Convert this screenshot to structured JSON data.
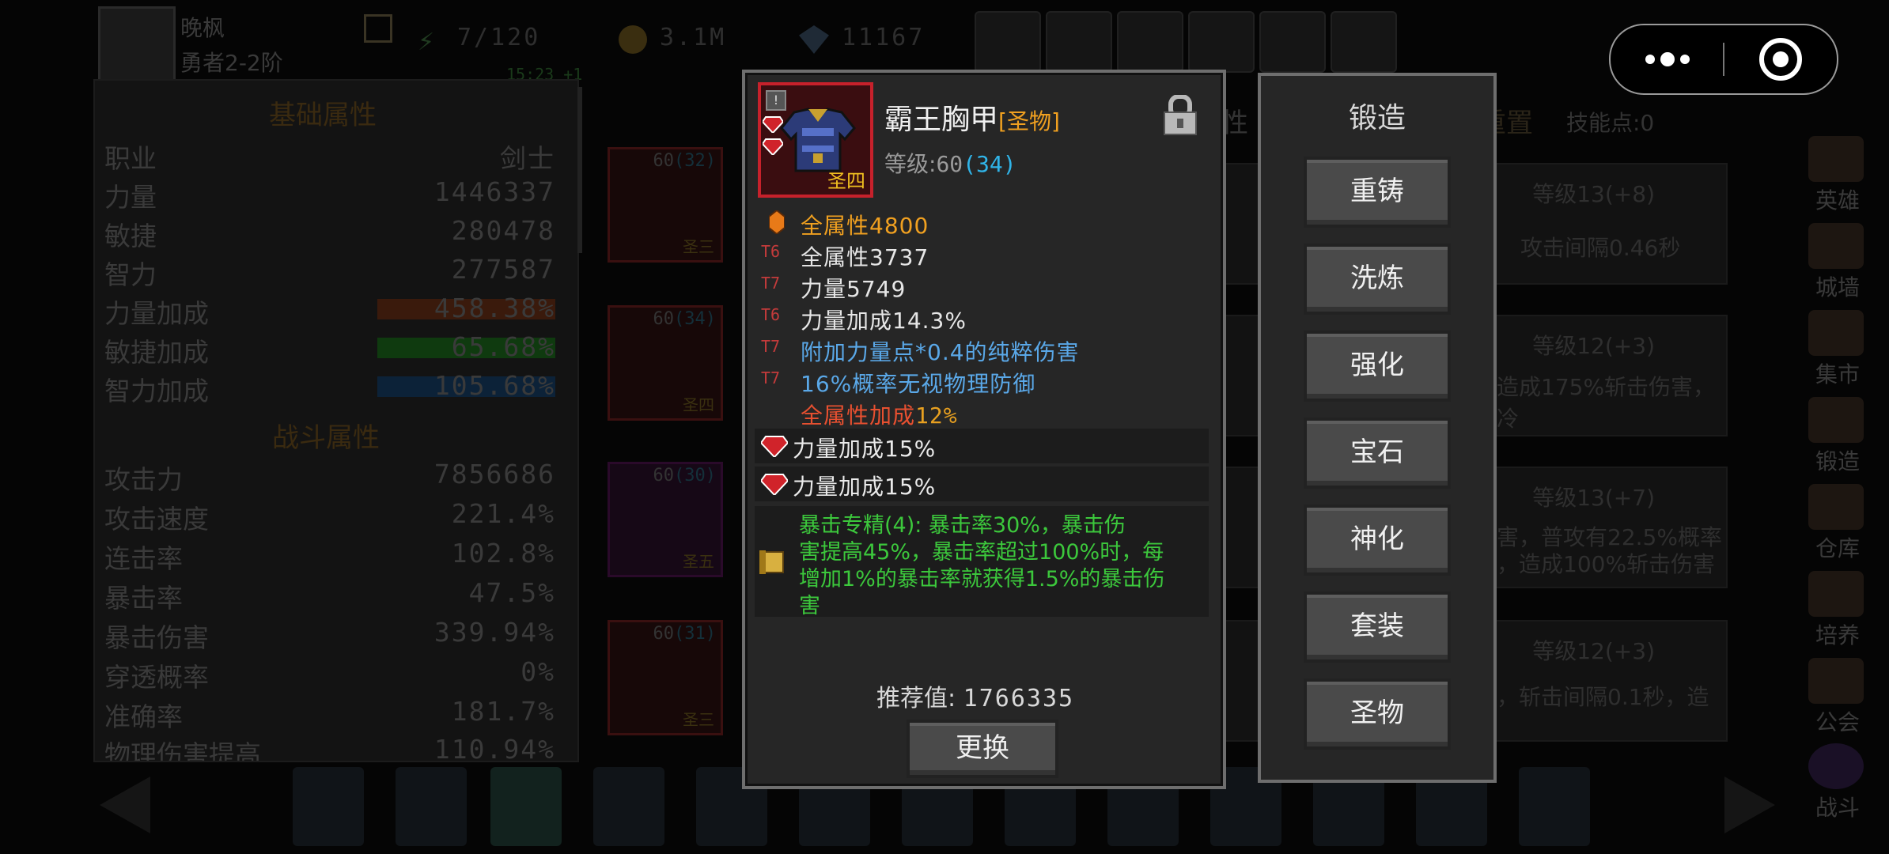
{
  "header": {
    "player_name": "晚枫",
    "player_rank": "勇者2-2阶",
    "stamina": "7/120",
    "stamina_timer": "15:23 +1",
    "gold": "3.1M",
    "diamonds": "11167"
  },
  "capsule": {
    "more_icon": "dots-icon",
    "close_icon": "target-icon"
  },
  "left_panel": {
    "basic_title": "基础属性",
    "basic_stats": [
      {
        "name": "职业",
        "value": "剑士"
      },
      {
        "name": "力量",
        "value": "1446337"
      },
      {
        "name": "敏捷",
        "value": "280478"
      },
      {
        "name": "智力",
        "value": "277587"
      },
      {
        "name": "力量加成",
        "value": "458.38%",
        "bar_color": "#3a1a0c"
      },
      {
        "name": "敏捷加成",
        "value": "65.68%",
        "bar_color": "#0f3a0f"
      },
      {
        "name": "智力加成",
        "value": "105.68%",
        "bar_color": "#0c2238"
      }
    ],
    "combat_title": "战斗属性",
    "combat_stats": [
      {
        "name": "攻击力",
        "value": "7856686"
      },
      {
        "name": "攻击速度",
        "value": "221.4%"
      },
      {
        "name": "连击率",
        "value": "102.8%"
      },
      {
        "name": "暴击率",
        "value": "47.5%"
      },
      {
        "name": "暴击伤害",
        "value": "339.94%"
      },
      {
        "name": "穿透概率",
        "value": "0%"
      },
      {
        "name": "准确率",
        "value": "181.7%"
      },
      {
        "name": "物理伤害提高",
        "value": "110.94%"
      }
    ]
  },
  "equipped_items": [
    {
      "level": "60",
      "extra": "(32)",
      "tag": "圣三"
    },
    {
      "level": "60",
      "extra": "(34)",
      "tag": "圣四"
    },
    {
      "level": "60",
      "extra": "(30)",
      "tag": "圣五"
    },
    {
      "level": "60",
      "extra": "(31)",
      "tag": "圣三"
    }
  ],
  "skills": {
    "tab_partial": "性",
    "reset_label": "重置",
    "skill_points": "技能点:0",
    "cards": [
      {
        "level": "等级13(+8)",
        "desc": "攻击间隔0.46秒"
      },
      {
        "level": "等级12(+3)",
        "desc": "造成175%斩击伤害，冷"
      },
      {
        "level": "等级13(+7)",
        "desc": "害，普攻有22.5%概率",
        "desc2": "，造成100%斩击伤害"
      },
      {
        "level": "等级12(+3)",
        "desc": "，斩击间隔0.1秒，造"
      }
    ]
  },
  "right_nav": [
    "英雄",
    "城墙",
    "集市",
    "锻造",
    "仓库",
    "培养",
    "公会",
    "战斗"
  ],
  "item": {
    "name": "霸王胸甲",
    "quality": "[圣物]",
    "grade_badge": "圣四",
    "level_label": "等级:",
    "level": "60",
    "level_extra": "(34)",
    "lock_icon": "lock-icon",
    "main_stat": "全属性4800",
    "affixes": [
      {
        "tier": "T6",
        "text": "全属性3737",
        "color": "#e6e6e6"
      },
      {
        "tier": "T7",
        "text": "力量5749",
        "color": "#e6e6e6"
      },
      {
        "tier": "T6",
        "text": "力量加成14.3%",
        "color": "#e6e6e6"
      },
      {
        "tier": "T7",
        "text": "附加力量点*0.4的纯粹伤害",
        "color": "#5aa8e8"
      },
      {
        "tier": "T7",
        "text": "16%概率无视物理防御",
        "color": "#5aa8e8"
      }
    ],
    "bonus_prefix": "全属性加成",
    "bonus_value": "12%",
    "gems": [
      "力量加成15%",
      "力量加成15%"
    ],
    "set_effect": {
      "line1": "暴击专精(4): 暴击率30%，暴击伤",
      "line2": "害提高45%，暴击率超过100%时，每",
      "line3": "增加1%的暴击率就获得1.5%的暴击伤",
      "line4": "害"
    },
    "recommend_label": "推荐值:",
    "recommend_value": "1766335",
    "replace_label": "更换"
  },
  "forge": {
    "title": "锻造",
    "buttons": [
      "重铸",
      "洗炼",
      "强化",
      "宝石",
      "神化",
      "套装",
      "圣物"
    ]
  },
  "colors": {
    "popup_bg": "#262626",
    "orange": "#f0a020",
    "cyan": "#30b4e8",
    "green": "#3cc83c",
    "red_border": "#c6212b"
  }
}
